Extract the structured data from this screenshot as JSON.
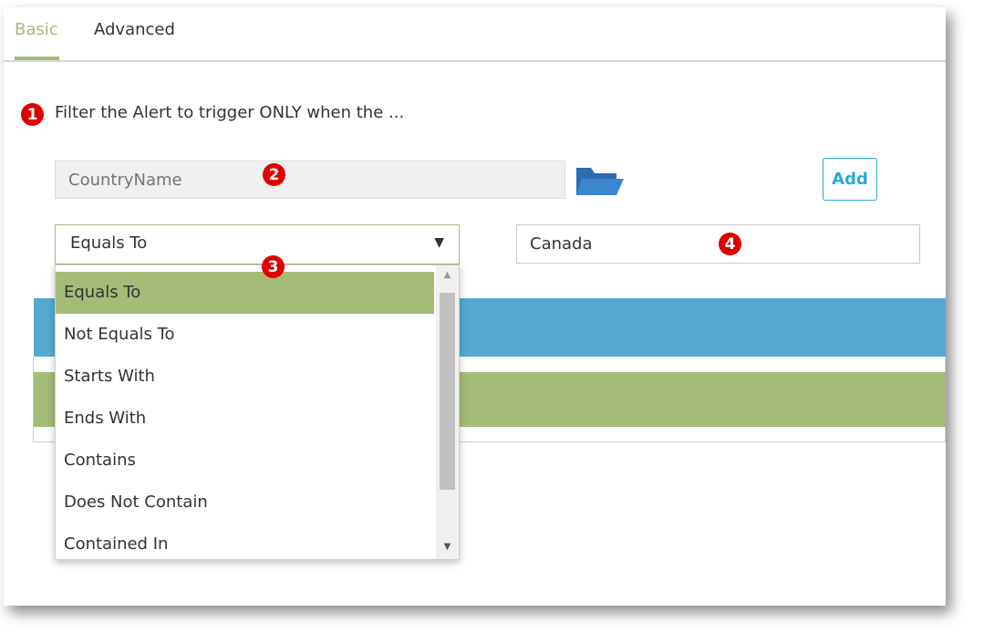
{
  "tabs": {
    "basic": "Basic",
    "advanced": "Advanced"
  },
  "badges": {
    "b1": "1",
    "b2": "2",
    "b3": "3",
    "b4": "4"
  },
  "instruction": "Filter the Alert to trigger ONLY when the ...",
  "field": {
    "placeholder": "CountryName",
    "icon": "folder-open-icon"
  },
  "add_button": "Add",
  "operator_select": {
    "value": "Equals To",
    "icon": "caret-down-icon"
  },
  "value_input": {
    "value": "Canada"
  },
  "dropdown": {
    "options": [
      "Equals To",
      "Not Equals To",
      "Starts With",
      "Ends With",
      "Contains",
      "Does Not Contain",
      "Contained In"
    ],
    "selected_index": 0
  },
  "colors": {
    "accent_green": "#a5bb78",
    "accent_blue": "#29a8e0",
    "band_blue": "#56a9cf",
    "badge_red": "#e00000"
  }
}
